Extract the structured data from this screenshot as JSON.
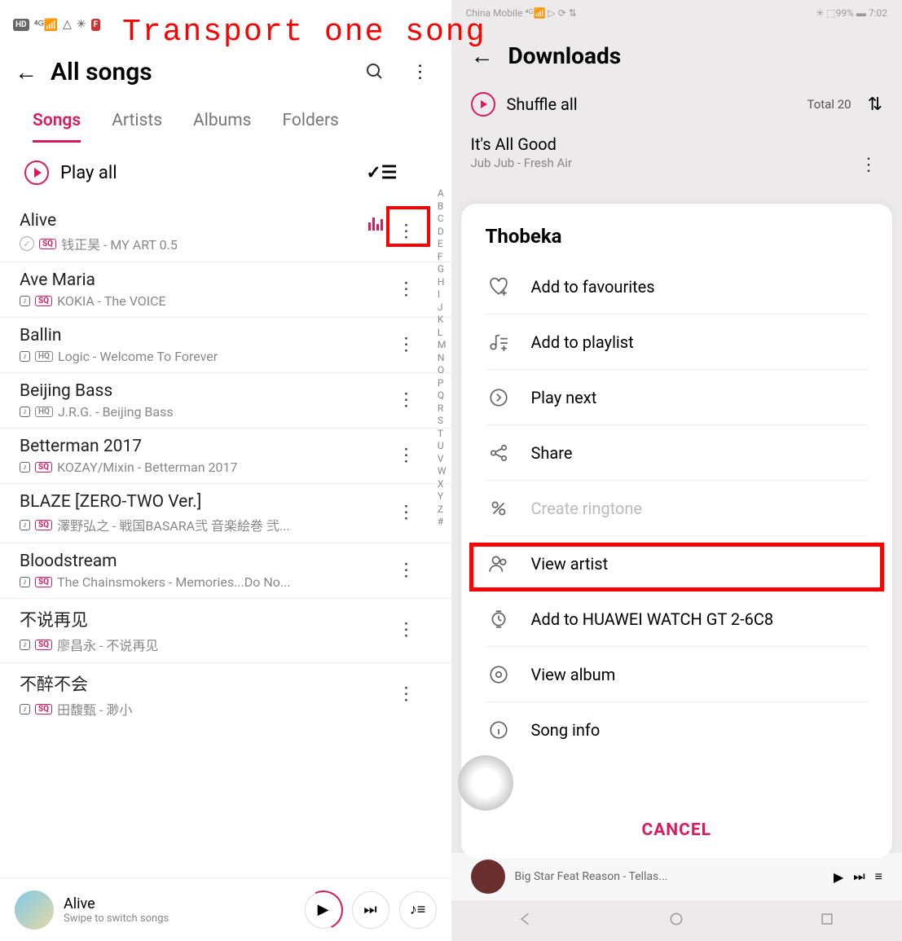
{
  "overlay_title": "Transport one song",
  "left": {
    "header": {
      "back": "←",
      "title": "All songs"
    },
    "tabs": [
      "Songs",
      "Artists",
      "Albums",
      "Folders"
    ],
    "active_tab": 0,
    "play_all": "Play all",
    "songs": [
      {
        "title": "Alive",
        "meta": "钱正昊 - MY ART 0.5",
        "sd": false,
        "sq": true,
        "hq": false,
        "playing": true,
        "check": true
      },
      {
        "title": "Ave Maria",
        "meta": "KOKIA - The VOICE",
        "sd": true,
        "sq": true,
        "hq": false
      },
      {
        "title": "Ballin",
        "meta": "Logic - Welcome To Forever",
        "sd": true,
        "sq": false,
        "hq": true
      },
      {
        "title": "Beijing Bass",
        "meta": "J.R.G. - Beijing Bass",
        "sd": true,
        "sq": false,
        "hq": true
      },
      {
        "title": "Betterman 2017",
        "meta": "KOZAY/Mixin - Betterman 2017",
        "sd": true,
        "sq": true,
        "hq": false
      },
      {
        "title": "BLAZE [ZERO-TWO Ver.]",
        "meta": "澤野弘之 - 戦国BASARA弐 音楽絵巻 弐...",
        "sd": true,
        "sq": true,
        "hq": false
      },
      {
        "title": "Bloodstream",
        "meta": "The Chainsmokers - Memories...Do No...",
        "sd": true,
        "sq": true,
        "hq": false
      },
      {
        "title": "不说再见",
        "meta": "廖昌永 - 不说再见",
        "sd": true,
        "sq": true,
        "hq": false
      },
      {
        "title": "不醉不会",
        "meta": "田馥甄 - 渺小",
        "sd": true,
        "sq": true,
        "hq": false
      }
    ],
    "alpha": [
      "A",
      "B",
      "C",
      "D",
      "E",
      "F",
      "G",
      "H",
      "I",
      "J",
      "K",
      "L",
      "M",
      "N",
      "O",
      "P",
      "Q",
      "R",
      "S",
      "T",
      "U",
      "V",
      "W",
      "X",
      "Y",
      "Z",
      "#"
    ],
    "np": {
      "title": "Alive",
      "sub": "Swipe to switch songs"
    }
  },
  "right": {
    "status": {
      "carrier": "China Mobile",
      "batt": "99%",
      "time": "7:02"
    },
    "header": {
      "title": "Downloads"
    },
    "shuffle": "Shuffle all",
    "total": "Total 20",
    "bgsong": {
      "title": "It's All Good",
      "meta": "Jub Jub - Fresh Air"
    },
    "sheet": {
      "title": "Thobeka",
      "items": [
        {
          "label": "Add to favourites",
          "icon": "heart"
        },
        {
          "label": "Add to playlist",
          "icon": "playlist"
        },
        {
          "label": "Play next",
          "icon": "playnext"
        },
        {
          "label": "Share",
          "icon": "share"
        },
        {
          "label": "Create ringtone",
          "icon": "ringtone",
          "disabled": true
        },
        {
          "label": "View artist",
          "icon": "artist"
        },
        {
          "label": "Add to HUAWEI WATCH GT 2-6C8",
          "icon": "watch",
          "highlight": true
        },
        {
          "label": "View album",
          "icon": "album"
        },
        {
          "label": "Song info",
          "icon": "info"
        }
      ],
      "cancel": "CANCEL"
    },
    "bp_text": "Big Star Feat Reason - Tellas..."
  }
}
